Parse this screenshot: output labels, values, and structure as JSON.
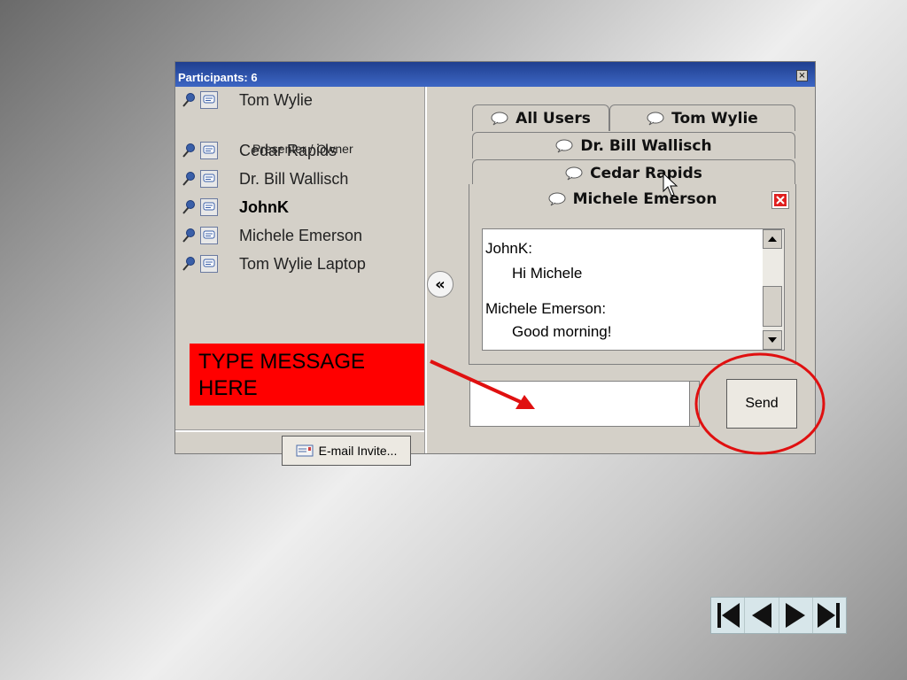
{
  "window": {
    "title": "Participants: 6",
    "close_glyph": "×"
  },
  "participants": {
    "items": [
      {
        "name": "Tom Wylie",
        "bold": false
      },
      {
        "name": "Cedar Rapids",
        "bold": false
      },
      {
        "name": "Dr. Bill Wallisch",
        "bold": false
      },
      {
        "name": "JohnK",
        "bold": true
      },
      {
        "name": "Michele Emerson",
        "bold": false
      },
      {
        "name": "Tom Wylie Laptop",
        "bold": false
      }
    ],
    "presenter_role": "Presenter / Owner",
    "email_button_label": "E-mail Invite...",
    "collapse_glyph": "«"
  },
  "annotation": {
    "type_message_line1": "TYPE MESSAGE",
    "type_message_line2": "HERE",
    "colors": {
      "callout": "#ff0000",
      "circle": "#e01010"
    }
  },
  "chat": {
    "tabs": [
      "All Users",
      "Tom Wylie",
      "Dr. Bill Wallisch",
      "Cedar Rapids"
    ],
    "active_tab": "Michele Emerson",
    "messages": [
      {
        "sender": "JohnK:",
        "text": "Hi Michele"
      },
      {
        "sender": "Michele Emerson:",
        "text": "Good morning!"
      }
    ],
    "send_label": "Send",
    "input_value": ""
  },
  "nav": {
    "buttons": [
      "first-icon",
      "prev-icon",
      "next-icon",
      "last-icon"
    ]
  }
}
